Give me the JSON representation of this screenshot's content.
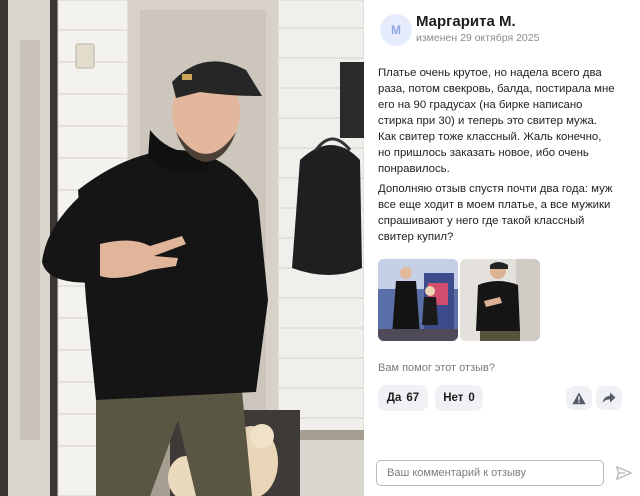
{
  "review": {
    "avatar_letter": "М",
    "author": "Маргарита М.",
    "edited": "изменен 29 октября 2025",
    "paragraph1_lines": [
      "Платье очень крутое, но надела всего два",
      "раза, потом свекровь, балда, постирала мне",
      "его на 90 градусах (на бирке написано",
      "стирка при 30) и теперь это свитер мужа.",
      "Как свитер тоже классный. Жаль конечно,",
      "но пришлось заказать новое, ибо очень",
      "понравилось."
    ],
    "paragraph2_lines": [
      "Дополняю отзыв спустя почти два года: муж",
      "все еще ходит в моем платье, а все мужики",
      "спрашивают у него где такой классный",
      "свитер купил?"
    ]
  },
  "helpful": {
    "question": "Вам помог этот отзыв?",
    "yes_label": "Да",
    "yes_count": "67",
    "no_label": "Нет",
    "no_count": "0"
  },
  "actions": {
    "report_icon": "warning-icon",
    "share_icon": "share-arrow-icon"
  },
  "comment": {
    "placeholder": "Ваш комментарий к отзыву",
    "send_icon": "send-icon"
  },
  "colors": {
    "avatar_bg": "#e6ecfb",
    "avatar_text": "#8da5e6",
    "pill_bg": "#f0f1f5",
    "muted_text": "#8a8a8a"
  }
}
